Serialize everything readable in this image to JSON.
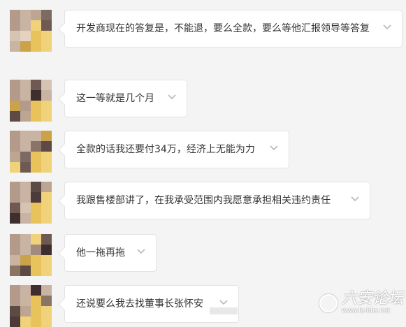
{
  "messages": [
    {
      "text": "开发商现在的答复是，不能退，要么全款，要么等他汇报领导等答复"
    },
    {
      "text": "这一等就是几个月"
    },
    {
      "text": "全款的话我还要付34万，经济上无能为力"
    },
    {
      "text": "我跟售楼部讲了，在我承受范围内我愿意承担相关违约责任"
    },
    {
      "text": "他一拖再拖"
    },
    {
      "text": "还说要么我去找董事长张怀安"
    }
  ],
  "watermark": {
    "title": "六安论坛",
    "url": "www.la-bbs.net"
  },
  "colors": {
    "background": "#f4f4f4",
    "bubble": "#ffffff",
    "border": "#e3e3e3",
    "text": "#333333",
    "chevron": "#b8b8b8"
  },
  "icons": {
    "expand": "chevron-down-icon",
    "avatar": "pixelated-avatar"
  }
}
